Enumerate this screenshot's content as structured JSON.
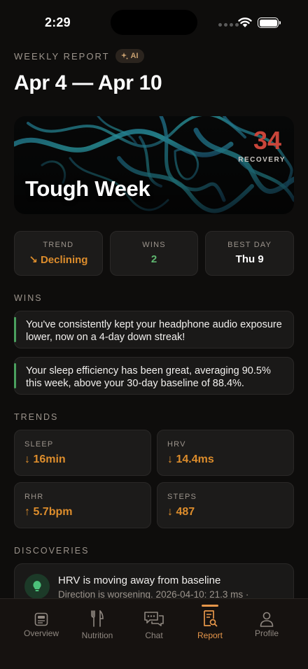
{
  "status_bar": {
    "time": "2:29"
  },
  "header": {
    "eyebrow": "WEEKLY REPORT",
    "ai_badge": "AI",
    "title": "Apr 4 — Apr 10"
  },
  "hero": {
    "title": "Tough Week",
    "score": "34",
    "score_label": "RECOVERY",
    "score_color": "#c9453a"
  },
  "stats": [
    {
      "label": "TREND",
      "value": "↘ Declining",
      "color": "#dd8d2c"
    },
    {
      "label": "WINS",
      "value": "2",
      "color": "#5fb870"
    },
    {
      "label": "BEST DAY",
      "value": "Thu 9",
      "color": "#ffffff"
    }
  ],
  "wins": {
    "label": "WINS",
    "items": [
      "You've consistently kept your headphone audio exposure lower, now on a 4-day down streak!",
      "Your sleep efficiency has been great, averaging 90.5% this week, above your 30-day baseline of 88.4%."
    ]
  },
  "trends": {
    "label": "TRENDS",
    "items": [
      {
        "label": "SLEEP",
        "value": "↓ 16min"
      },
      {
        "label": "HRV",
        "value": "↓ 14.4ms"
      },
      {
        "label": "RHR",
        "value": "↑ 5.7bpm"
      },
      {
        "label": "STEPS",
        "value": "↓ 487"
      }
    ]
  },
  "discoveries": {
    "label": "DISCOVERIES",
    "item": {
      "icon": "lightbulb-icon",
      "title": "HRV is moving away from baseline",
      "body": "Direction is worsening. 2026-04-10: 21.3 ms ·"
    }
  },
  "tabbar": {
    "tabs": [
      {
        "label": "Overview",
        "icon": "overview-icon"
      },
      {
        "label": "Nutrition",
        "icon": "nutrition-icon"
      },
      {
        "label": "Chat",
        "icon": "chat-icon"
      },
      {
        "label": "Report",
        "icon": "report-icon",
        "active": true
      },
      {
        "label": "Profile",
        "icon": "profile-icon"
      }
    ],
    "accent": "#e6964a"
  }
}
